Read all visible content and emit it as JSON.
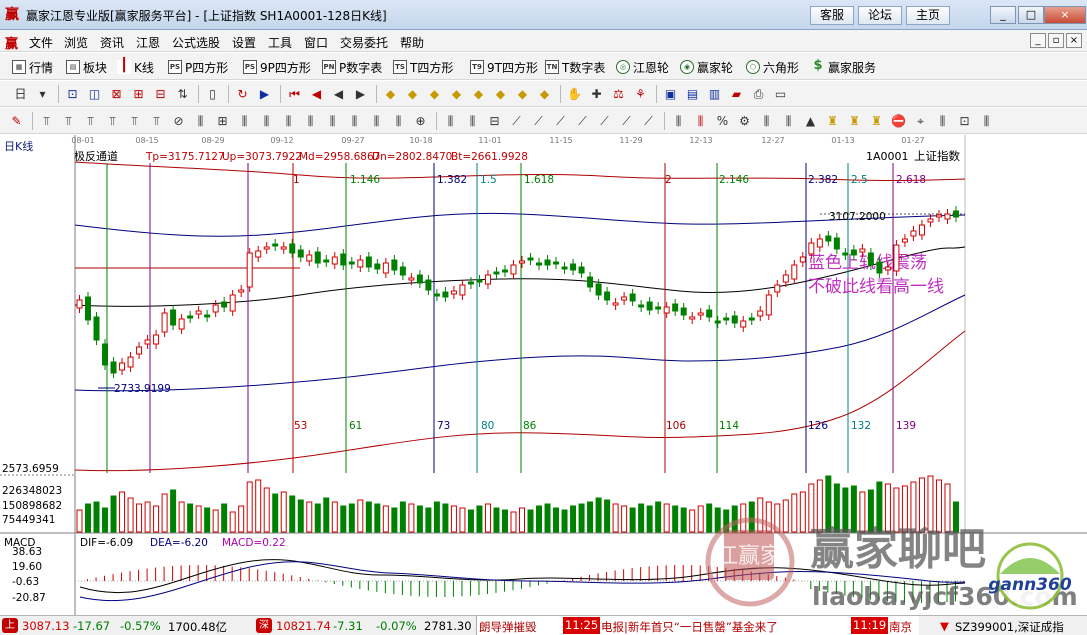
{
  "window": {
    "title": "赢家江恩专业版[赢家服务平台] - [上证指数  SH1A0001-128日K线]",
    "links": [
      "客服",
      "论坛",
      "主页"
    ],
    "controls": [
      "_",
      "□",
      "×"
    ]
  },
  "menu": {
    "items": [
      "文件",
      "浏览",
      "资讯",
      "江恩",
      "公式选股",
      "设置",
      "工具",
      "窗口",
      "交易委托",
      "帮助"
    ]
  },
  "toolbar": {
    "items": [
      {
        "label": "行情",
        "icon": "grid-icon"
      },
      {
        "label": "板块",
        "icon": "sector-icon"
      },
      {
        "label": "K线",
        "icon": "candlestick-icon"
      },
      {
        "label": "P四方形",
        "icon": "ps-icon",
        "icon_text": "PS"
      },
      {
        "label": "9P四方形",
        "icon": "ps-icon",
        "icon_text": "PS"
      },
      {
        "label": "P数字表",
        "icon": "pn-icon",
        "icon_text": "PN"
      },
      {
        "label": "T四方形",
        "icon": "ts-icon",
        "icon_text": "TS"
      },
      {
        "label": "9T四方形",
        "icon": "t9-icon",
        "icon_text": "T9"
      },
      {
        "label": "T数字表",
        "icon": "tn-icon",
        "icon_text": "TN"
      },
      {
        "label": "江恩轮",
        "icon": "gann-wheel-icon",
        "icon_text": "◎"
      },
      {
        "label": "赢家轮",
        "icon": "winner-wheel-icon",
        "icon_text": "◉"
      },
      {
        "label": "六角形",
        "icon": "hexagon-icon",
        "icon_text": "⬡"
      },
      {
        "label": "赢家服务",
        "icon": "dollar-icon",
        "icon_text": "$"
      }
    ]
  },
  "chart": {
    "period_label": "日K线",
    "indicator_name": "极反通道",
    "indicator_values": [
      "Tp=3175.7127",
      "Up=3073.7922",
      "Md=2958.6867",
      "Dn=2802.8470",
      "Bt=2661.9928"
    ],
    "code": "1A0001",
    "name": "上证指数",
    "date_ticks": [
      "08-01",
      "08-15",
      "08-29",
      "09-12",
      "09-27",
      "10-18",
      "11-01",
      "11-15",
      "11-29",
      "12-13",
      "12-27",
      "01-13",
      "01-27"
    ],
    "gann_ratios": [
      "1",
      "1.146",
      "1.382",
      "1.5",
      "1.618",
      "2",
      "2.146",
      "2.382",
      "2.5",
      "2.618"
    ],
    "day_counts": [
      "53",
      "61",
      "73",
      "80",
      "86",
      "106",
      "114",
      "126",
      "132",
      "139"
    ],
    "high_annotation": "3107.2000",
    "low_annotation": "2733.9199",
    "price_axis_label": "2573.6959",
    "volume_axis": [
      "226348023",
      "150898682",
      "75449341"
    ],
    "comment_lines": [
      "蓝色上轨线震荡",
      "不破此线看高一线"
    ]
  },
  "macd": {
    "title": "MACD",
    "dif": "DIF=-6.09",
    "dea": "DEA=-6.20",
    "macd": "MACD=0.22",
    "axis": [
      "38.63",
      "19.60",
      "-0.63",
      "-20.87"
    ]
  },
  "status": {
    "sh_index": "3087.13",
    "sh_change": "-17.67",
    "sh_pct": "-0.57%",
    "sh_amount": "1700.48亿",
    "sz_badge": "深",
    "sz_index": "10821.74",
    "sz_change": "-7.31",
    "sz_pct": "-0.07%",
    "sz_amount": "2781.30",
    "news": [
      {
        "time": "",
        "text": "朗导弹摧毁"
      },
      {
        "time": "11:25",
        "text": "电报|新年首只“一日售罄”基金来了"
      },
      {
        "time": "11:19",
        "text": "南京"
      }
    ],
    "ticker_right": "SZ399001,深证成指"
  },
  "watermark": {
    "seal_text": "江赢家",
    "site_name": "赢家聊吧",
    "url": "liaoba.yjcf360.com",
    "logo": "gann360"
  }
}
